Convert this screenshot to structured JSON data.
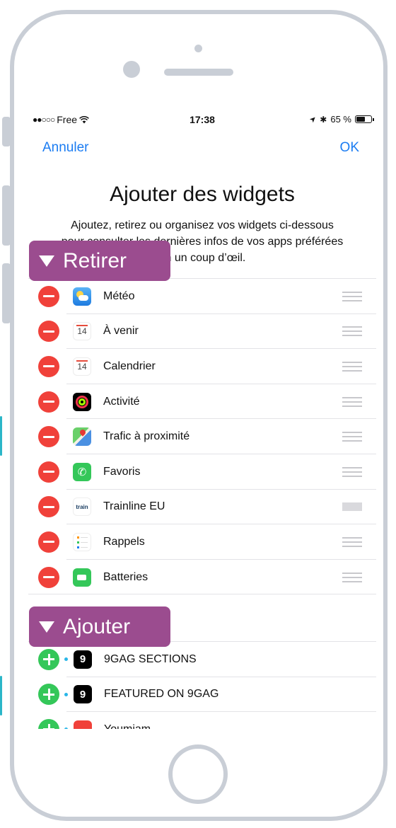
{
  "status_bar": {
    "signal": "●●○○○",
    "carrier": "Free",
    "wifi_icon": "wifi-icon",
    "time": "17:38",
    "location_icon": "➤",
    "bluetooth_icon": "✱",
    "battery_percent": "65 %",
    "battery_level": 0.65
  },
  "nav": {
    "cancel_label": "Annuler",
    "ok_label": "OK"
  },
  "header": {
    "title": "Ajouter des widgets",
    "description": "Ajoutez, retirez ou organisez vos widgets ci-dessous pour consulter les dernières infos de vos apps préférées en un coup d’œil."
  },
  "remove_section": {
    "tag_label": "Retirer",
    "items": [
      {
        "label": "Météo",
        "icon": "weather-icon"
      },
      {
        "label": "À venir",
        "icon": "calendar-icon",
        "icon_text": "14"
      },
      {
        "label": "Calendrier",
        "icon": "calendar-icon",
        "icon_text": "14"
      },
      {
        "label": "Activité",
        "icon": "activity-icon"
      },
      {
        "label": "Trafic à proximité",
        "icon": "maps-icon"
      },
      {
        "label": "Favoris",
        "icon": "phone-icon",
        "icon_text": "✆"
      },
      {
        "label": "Trainline EU",
        "icon": "trainline-icon",
        "icon_text": "train"
      },
      {
        "label": "Rappels",
        "icon": "reminders-icon"
      },
      {
        "label": "Batteries",
        "icon": "battery-icon"
      }
    ]
  },
  "add_section": {
    "tag_label": "Ajouter",
    "items": [
      {
        "label": "9GAG SECTIONS",
        "icon": "9gag-icon",
        "icon_text": "9"
      },
      {
        "label": "FEATURED ON 9GAG",
        "icon": "9gag-icon",
        "icon_text": "9"
      },
      {
        "label": "Youmiam",
        "icon": "youmiam-icon"
      }
    ]
  },
  "colors": {
    "accent": "#1b7cf2",
    "remove": "#f0413a",
    "add": "#34c759",
    "tag": "#9b4c8f",
    "phone_frame": "#c9ced6"
  }
}
